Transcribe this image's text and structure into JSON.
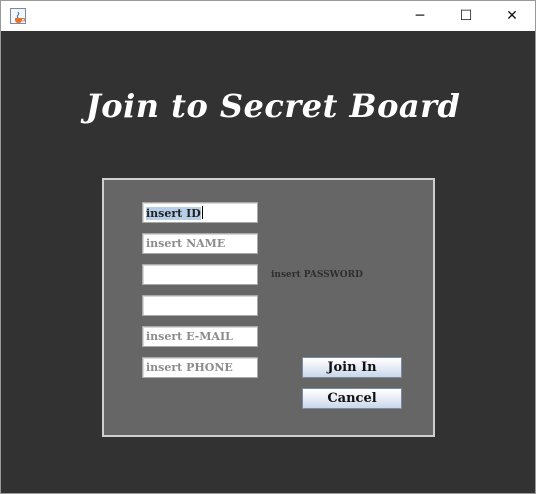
{
  "window": {
    "app_icon": "java-cup-icon",
    "controls": {
      "minimize": "─",
      "maximize": "☐",
      "close": "✕"
    }
  },
  "heading": "Join to Secret Board",
  "form": {
    "id_value": "insert ID",
    "name_placeholder": "insert NAME",
    "password_value": "",
    "password_confirm_value": "",
    "password_hint": "insert PASSWORD",
    "email_placeholder": "insert E-MAIL",
    "phone_placeholder": "insert PHONE"
  },
  "buttons": {
    "join": "Join In",
    "cancel": "Cancel"
  }
}
